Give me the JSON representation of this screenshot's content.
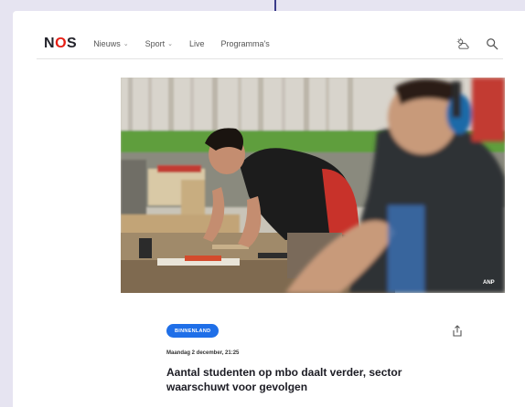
{
  "brand": {
    "logo_text_n": "N",
    "logo_text_o": "O",
    "logo_text_s": "S",
    "accent_color": "#e61e14"
  },
  "nav": {
    "items": [
      {
        "label": "Nieuws",
        "has_dropdown": true
      },
      {
        "label": "Sport",
        "has_dropdown": true
      },
      {
        "label": "Live",
        "has_dropdown": false
      },
      {
        "label": "Programma's",
        "has_dropdown": false
      }
    ],
    "chevron": "⌄"
  },
  "header_icons": [
    "weather-icon",
    "search-icon"
  ],
  "hero": {
    "credit": "ANP"
  },
  "article": {
    "tag": "Binnenland",
    "tag_color": "#1f6fe8",
    "date": "Maandag 2 december, 21:25",
    "headline": "Aantal studenten op mbo daalt verder, sector waarschuwt voor gevolgen"
  }
}
